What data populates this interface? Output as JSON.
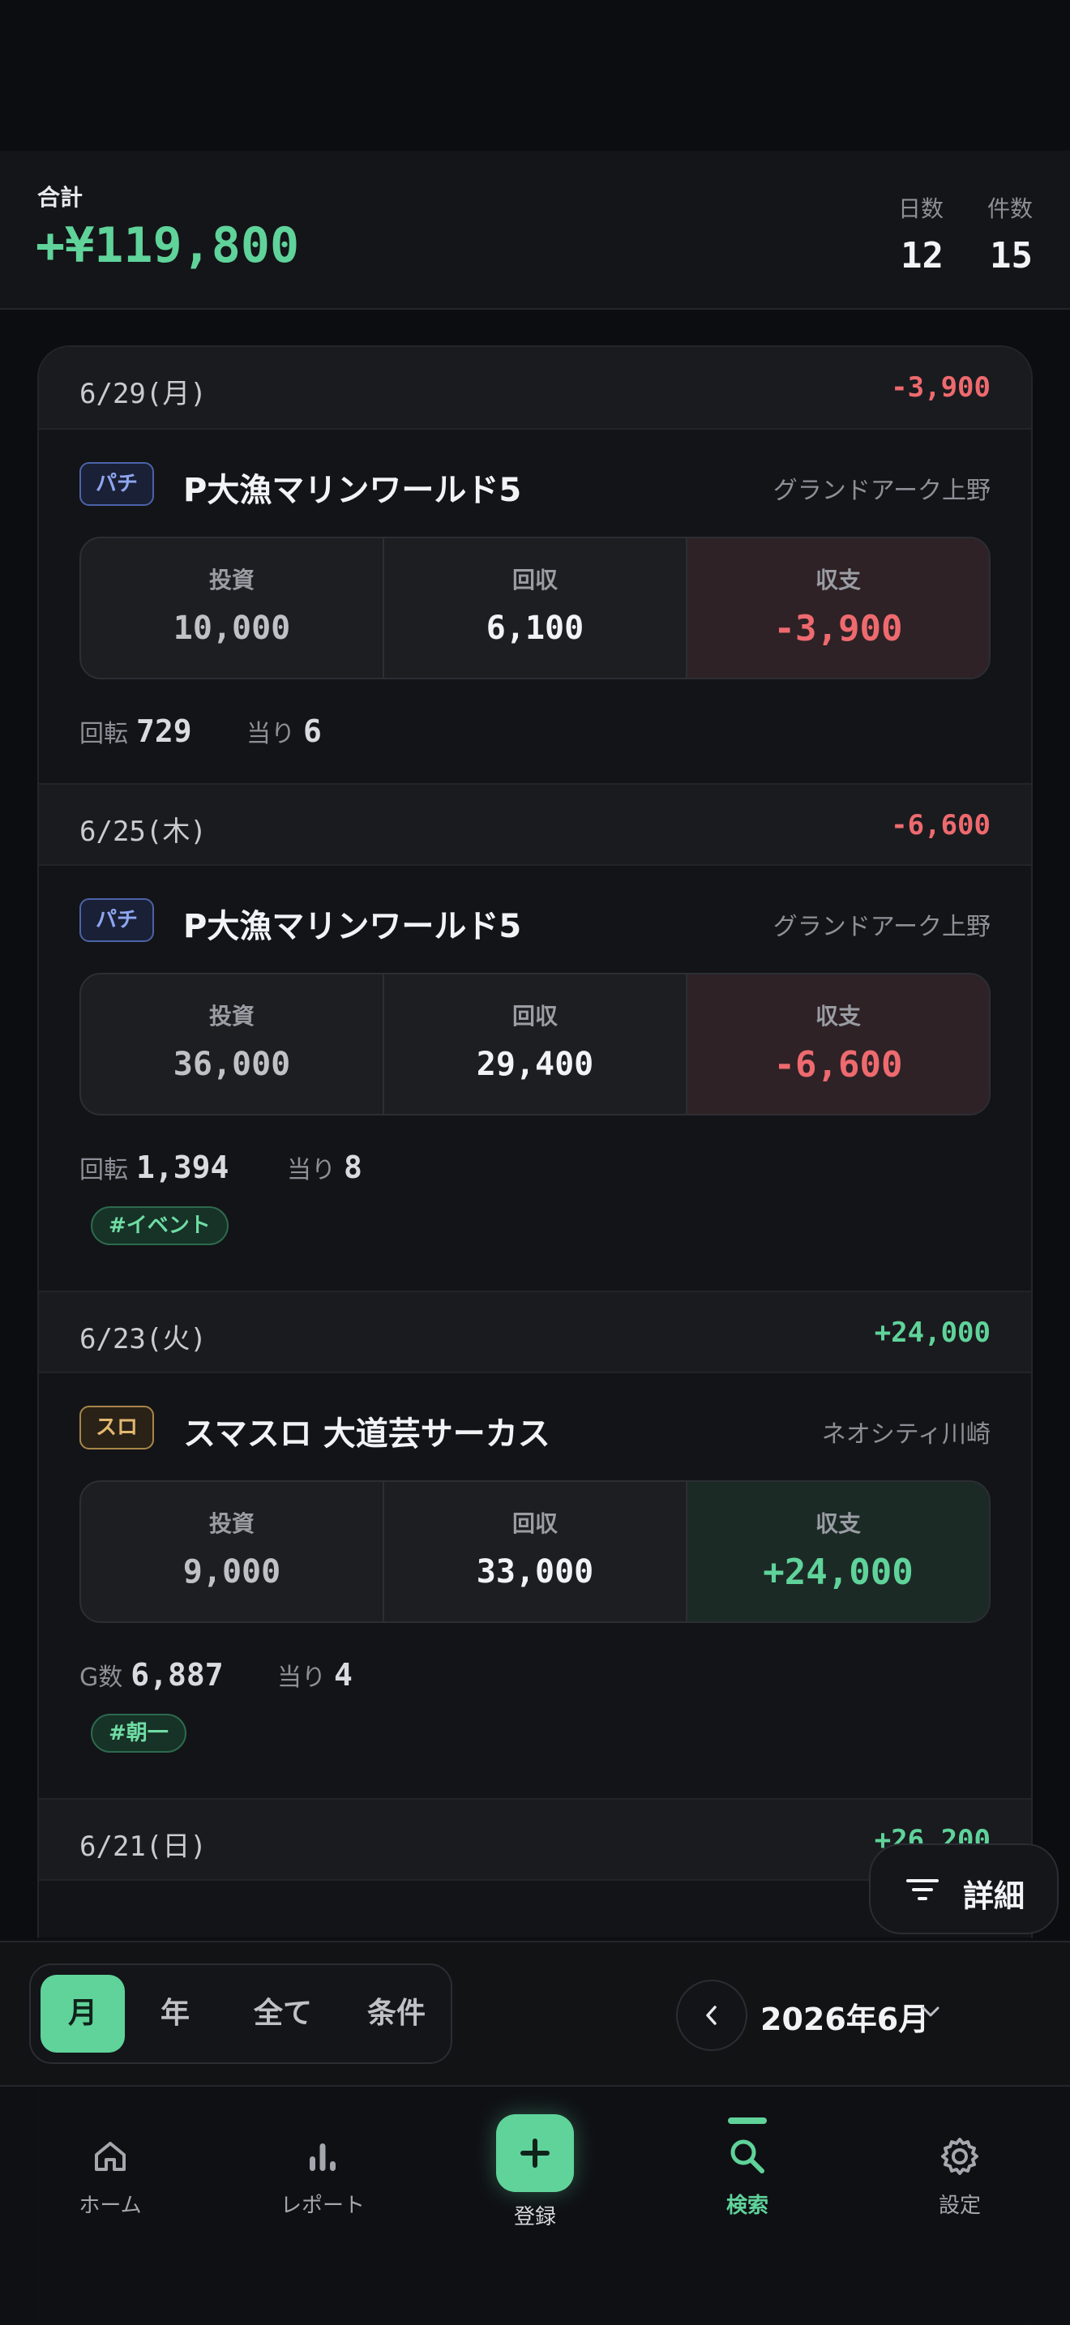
{
  "summary": {
    "label": "合計",
    "total": "+¥119,800",
    "days_label": "日数",
    "days_value": "12",
    "count_label": "件数",
    "count_value": "15"
  },
  "labels": {
    "invest": "投資",
    "return": "回収",
    "balance": "収支",
    "spins": "回転",
    "games": "G数",
    "hits": "当り"
  },
  "days": [
    {
      "date": "6/29(月)",
      "amount": "-3,900",
      "entry": {
        "type": "パチ",
        "machine": "P大漁マリンワールド5",
        "store": "グランドアーク上野",
        "invest": "10,000",
        "return": "6,100",
        "balance": "-3,900",
        "count": "729",
        "hits": "6"
      }
    },
    {
      "date": "6/25(木)",
      "amount": "-6,600",
      "entry": {
        "type": "パチ",
        "machine": "P大漁マリンワールド5",
        "store": "グランドアーク上野",
        "invest": "36,000",
        "return": "29,400",
        "balance": "-6,600",
        "count": "1,394",
        "hits": "8",
        "tag": "#イベント"
      }
    },
    {
      "date": "6/23(火)",
      "amount": "+24,000",
      "entry": {
        "type": "スロ",
        "machine": "スマスロ 大道芸サーカス",
        "store": "ネオシティ川崎",
        "invest": "9,000",
        "return": "33,000",
        "balance": "+24,000",
        "count": "6,887",
        "hits": "4",
        "tag": "#朝一"
      }
    },
    {
      "date": "6/21(日)",
      "amount": "+26,200"
    }
  ],
  "detail_button": "詳細",
  "filter": {
    "options": [
      "月",
      "年",
      "全て",
      "条件"
    ],
    "selected": "月",
    "month_label": "2026年6月"
  },
  "tabs": {
    "home": "ホーム",
    "report": "レポート",
    "add": "登録",
    "search": "検索",
    "settings": "設定"
  },
  "colors": {
    "positive": "#5fd39a",
    "negative": "#ee6a6f",
    "accent": "#5fd39a",
    "background": "#0c0d10"
  }
}
